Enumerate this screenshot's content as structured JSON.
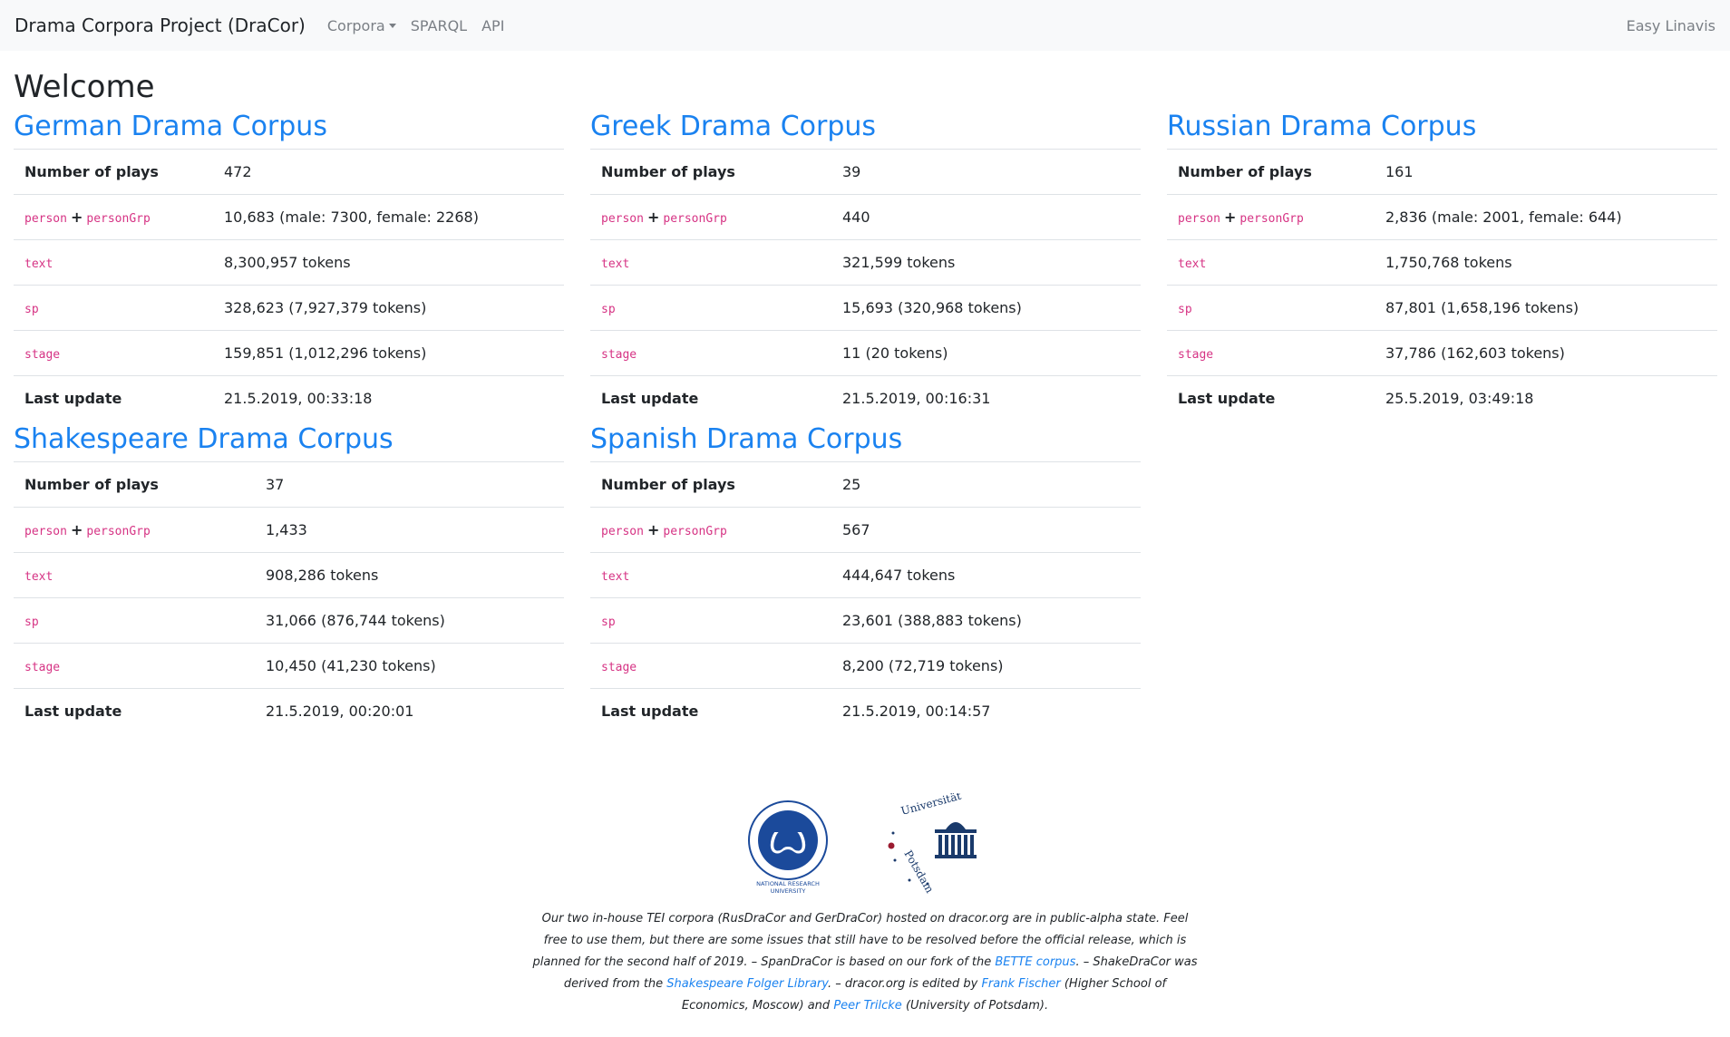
{
  "navbar": {
    "brand": "Drama Corpora Project (DraCor)",
    "corpora": "Corpora",
    "sparql": "SPARQL",
    "api": "API",
    "right": "Easy Linavis"
  },
  "page": {
    "title": "Welcome"
  },
  "labels": {
    "plays": "Number of plays",
    "person": "person",
    "plus": "+",
    "personGrp": "personGrp",
    "text": "text",
    "sp": "sp",
    "stage": "stage",
    "update": "Last update"
  },
  "corpora": {
    "german": {
      "title": "German Drama Corpus",
      "plays": "472",
      "persons": "10,683 (male: 7300, female: 2268)",
      "text": "8,300,957 tokens",
      "sp": "328,623 (7,927,379 tokens)",
      "stage": "159,851 (1,012,296 tokens)",
      "update": "21.5.2019, 00:33:18"
    },
    "greek": {
      "title": "Greek Drama Corpus",
      "plays": "39",
      "persons": "440",
      "text": "321,599 tokens",
      "sp": "15,693 (320,968 tokens)",
      "stage": "11 (20 tokens)",
      "update": "21.5.2019, 00:16:31"
    },
    "russian": {
      "title": "Russian Drama Corpus",
      "plays": "161",
      "persons": "2,836 (male: 2001, female: 644)",
      "text": "1,750,768 tokens",
      "sp": "87,801 (1,658,196 tokens)",
      "stage": "37,786 (162,603 tokens)",
      "update": "25.5.2019, 03:49:18"
    },
    "shakespeare": {
      "title": "Shakespeare Drama Corpus",
      "plays": "37",
      "persons": "1,433",
      "text": "908,286 tokens",
      "sp": "31,066 (876,744 tokens)",
      "stage": "10,450 (41,230 tokens)",
      "update": "21.5.2019, 00:20:01"
    },
    "spanish": {
      "title": "Spanish Drama Corpus",
      "plays": "25",
      "persons": "567",
      "text": "444,647 tokens",
      "sp": "23,601 (388,883 tokens)",
      "stage": "8,200 (72,719 tokens)",
      "update": "21.5.2019, 00:14:57"
    }
  },
  "footer": {
    "hse_logo_text": "NATIONAL RESEARCH UNIVERSITY",
    "potsdam_logo_text": "Universität Potsdam",
    "t1": "Our two in-house TEI corpora (RusDraCor and GerDraCor) hosted on dracor.org are in public-alpha state. Feel free to use them, but there are some issues that still have to be resolved before the official release, which is planned for the second half of 2019. – SpanDraCor is based on our fork of the ",
    "link1": "BETTE corpus",
    "t2": ". – ShakeDraCor was derived from the ",
    "link2": "Shakespeare Folger Library",
    "t3": ". – dracor.org is edited by ",
    "link3": "Frank Fischer",
    "t4": " (Higher School of Economics, Moscow) and ",
    "link4": "Peer Trilcke",
    "t5": " (University of Potsdam)."
  },
  "colors": {
    "link": "#1a82f0",
    "code": "#d63384",
    "navbar_bg": "#f8f9fa",
    "hse_blue": "#1b4a9b",
    "potsdam_blue": "#1a3a6b",
    "potsdam_red": "#9b1b30"
  }
}
